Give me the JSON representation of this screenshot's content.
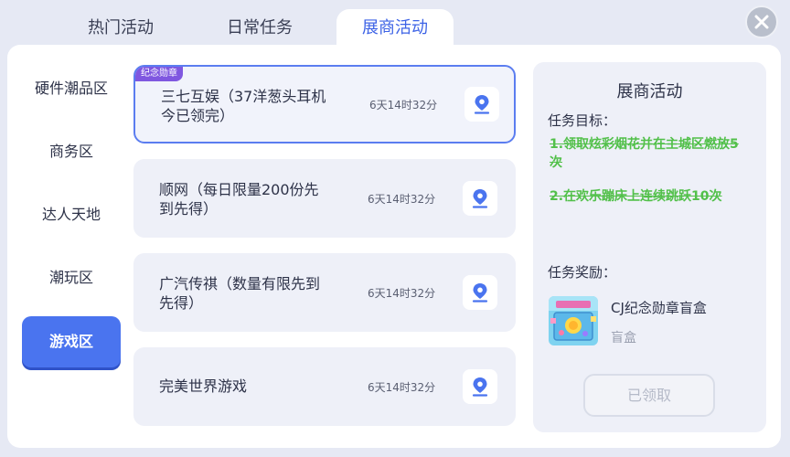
{
  "tabs": [
    {
      "label": "热门活动"
    },
    {
      "label": "日常任务"
    },
    {
      "label": "展商活动",
      "active": true
    }
  ],
  "sidebar": {
    "items": [
      {
        "label": "硬件潮品区"
      },
      {
        "label": "商务区"
      },
      {
        "label": "达人天地"
      },
      {
        "label": "潮玩区"
      },
      {
        "label": "游戏区",
        "active": true
      }
    ]
  },
  "activities": [
    {
      "title": "三七互娱（37洋葱头耳机今已领完）",
      "time": "6天14时32分",
      "badge": "纪念勋章",
      "selected": true
    },
    {
      "title": "顺网（每日限量200份先到先得）",
      "time": "6天14时32分"
    },
    {
      "title": "广汽传祺（数量有限先到先得）",
      "time": "6天14时32分"
    },
    {
      "title": "完美世界游戏",
      "time": "6天14时32分"
    }
  ],
  "detail": {
    "title": "展商活动",
    "goal_label": "任务目标：",
    "goals": [
      "1.领取炫彩烟花并在主城区燃放5次",
      "2.在欢乐蹦床上连续跳跃10次"
    ],
    "reward_label": "任务奖励：",
    "reward_name": "CJ纪念勋章盲盒",
    "reward_type": "盲盒",
    "claim_label": "已领取"
  },
  "colors": {
    "accent": "#4a74ef",
    "goal_done": "#52c04a",
    "badge": "#7f57e0"
  }
}
